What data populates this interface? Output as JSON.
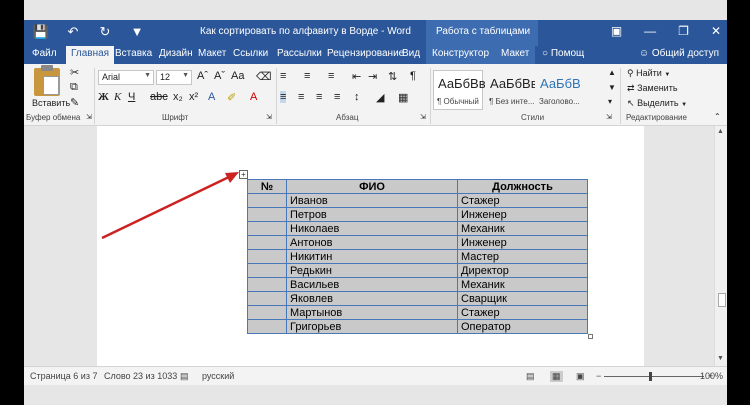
{
  "titlebar": {
    "title": "Как сортировать по алфавиту в Ворде - Word",
    "context_group": "Работа с таблицами",
    "icons": [
      "save-icon",
      "undo-icon",
      "redo-icon",
      "customize-icon"
    ]
  },
  "tabs": {
    "file": "Файл",
    "home": "Главная",
    "insert": "Вставка",
    "design": "Дизайн",
    "layout": "Макет",
    "references": "Ссылки",
    "mailings": "Рассылки",
    "review": "Рецензирование",
    "view": "Вид",
    "table_design": "Конструктор",
    "table_layout": "Макет",
    "tell_me": "Помощ",
    "share": "Общий доступ"
  },
  "ribbon": {
    "paste_label": "Вставить",
    "font_name": "Arial",
    "font_size": "12",
    "groups": {
      "clipboard": "Буфер обмена",
      "font": "Шрифт",
      "paragraph": "Абзац",
      "styles": "Стили",
      "editing": "Редактирование"
    },
    "styles": [
      {
        "sample": "АаБбВв",
        "name": "¶ Обычный"
      },
      {
        "sample": "АаБбВв",
        "name": "¶ Без инте..."
      },
      {
        "sample": "АаБбВ",
        "name": "Заголово..."
      }
    ],
    "editing": {
      "find": "Найти",
      "replace": "Заменить",
      "select": "Выделить"
    }
  },
  "table": {
    "headers": [
      "№",
      "ФИО",
      "Должность"
    ],
    "rows": [
      [
        "",
        "Иванов",
        "Стажер"
      ],
      [
        "",
        "Петров",
        "Инженер"
      ],
      [
        "",
        "Николаев",
        "Механик"
      ],
      [
        "",
        "Антонов",
        "Инженер"
      ],
      [
        "",
        "Никитин",
        "Мастер"
      ],
      [
        "",
        "Редькин",
        "Директор"
      ],
      [
        "",
        "Васильев",
        "Механик"
      ],
      [
        "",
        "Яковлев",
        "Сварщик"
      ],
      [
        "",
        "Мартынов",
        "Стажер"
      ],
      [
        "",
        "Григорьев",
        "Оператор"
      ]
    ]
  },
  "status": {
    "page": "Страница 6 из 7",
    "words": "Слово 23 из 1033",
    "language": "русский",
    "zoom": "100%"
  },
  "colors": {
    "accent": "#2b579a",
    "table_border": "#4a77b8",
    "cell_fill": "#c9c9c9",
    "arrow": "#cc2222"
  }
}
